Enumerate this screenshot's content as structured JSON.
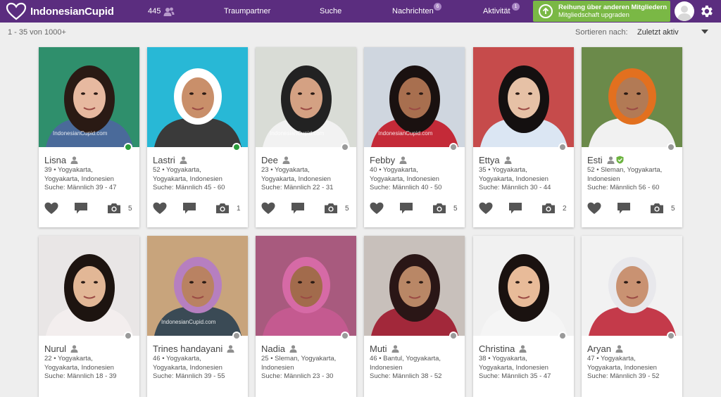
{
  "header": {
    "brand": "IndonesianCupid",
    "likes_count": "445",
    "nav": [
      {
        "label": "Traumpartner",
        "badge": ""
      },
      {
        "label": "Suche",
        "badge": ""
      },
      {
        "label": "Nachrichten",
        "badge": "6"
      },
      {
        "label": "Aktivität",
        "badge": "1"
      }
    ],
    "upgrade_title": "Reihung über anderen Mitgliedern",
    "upgrade_subtitle": "Mitgliedschaft upgraden"
  },
  "results": {
    "count_text": "1 - 35 von 1000+",
    "sort_label": "Sortieren nach:",
    "sort_value": "Zuletzt aktiv"
  },
  "colors": {
    "brand": "#5b2d7f",
    "upgrade": "#7ab845",
    "online": "#2a9d3b",
    "offline": "#9a9a9a",
    "verified": "#6cb33f"
  },
  "profiles": [
    {
      "name": "Lisna",
      "age_loc": "39 • Yogyakarta,",
      "loc2": "Yogyakarta, Indonesien",
      "search": "Suche: Männlich 39 - 47",
      "photos": "5",
      "online": true,
      "verified": false,
      "watermark": "IndonesianCupid.com"
    },
    {
      "name": "Lastri",
      "age_loc": "52 • Yogyakarta,",
      "loc2": "Yogyakarta, Indonesien",
      "search": "Suche: Männlich 45 - 60",
      "photos": "1",
      "online": true,
      "verified": false,
      "watermark": ""
    },
    {
      "name": "Dee",
      "age_loc": "23 • Yogyakarta,",
      "loc2": "Yogyakarta, Indonesien",
      "search": "Suche: Männlich 22 - 31",
      "photos": "5",
      "online": false,
      "verified": false,
      "watermark": "IndonesianCupid.com"
    },
    {
      "name": "Febby",
      "age_loc": "40 • Yogyakarta,",
      "loc2": "Yogyakarta, Indonesien",
      "search": "Suche: Männlich 40 - 50",
      "photos": "5",
      "online": false,
      "verified": false,
      "watermark": "IndonesianCupid.com"
    },
    {
      "name": "Ettya",
      "age_loc": "35 • Yogyakarta,",
      "loc2": "Yogyakarta, Indonesien",
      "search": "Suche: Männlich 30 - 44",
      "photos": "2",
      "online": false,
      "verified": false,
      "watermark": ""
    },
    {
      "name": "Esti",
      "age_loc": "52 • Sleman, Yogyakarta,",
      "loc2": "Indonesien",
      "search": "Suche: Männlich 56 - 60",
      "photos": "5",
      "online": false,
      "verified": true,
      "watermark": ""
    },
    {
      "name": "Nurul",
      "age_loc": "22 • Yogyakarta,",
      "loc2": "Yogyakarta, Indonesien",
      "search": "Suche: Männlich 18 - 39",
      "photos": "",
      "online": false,
      "verified": false,
      "watermark": ""
    },
    {
      "name": "Trines handayani",
      "age_loc": "46 • Yogyakarta,",
      "loc2": "Yogyakarta, Indonesien",
      "search": "Suche: Männlich 39 - 55",
      "photos": "",
      "online": false,
      "verified": false,
      "watermark": "IndonesianCupid.com"
    },
    {
      "name": "Nadia",
      "age_loc": "25 • Sleman, Yogyakarta,",
      "loc2": "Indonesien",
      "search": "Suche: Männlich 23 - 30",
      "photos": "",
      "online": false,
      "verified": false,
      "watermark": ""
    },
    {
      "name": "Muti",
      "age_loc": "46 • Bantul, Yogyakarta,",
      "loc2": "Indonesien",
      "search": "Suche: Männlich 38 - 52",
      "photos": "",
      "online": false,
      "verified": false,
      "watermark": ""
    },
    {
      "name": "Christina",
      "age_loc": "38 • Yogyakarta,",
      "loc2": "Yogyakarta, Indonesien",
      "search": "Suche: Männlich 35 - 47",
      "photos": "",
      "online": false,
      "verified": false,
      "watermark": ""
    },
    {
      "name": "Aryan",
      "age_loc": "47 • Yogyakarta,",
      "loc2": "Yogyakarta, Indonesien",
      "search": "Suche: Männlich 39 - 52",
      "photos": "",
      "online": false,
      "verified": false,
      "watermark": ""
    }
  ]
}
